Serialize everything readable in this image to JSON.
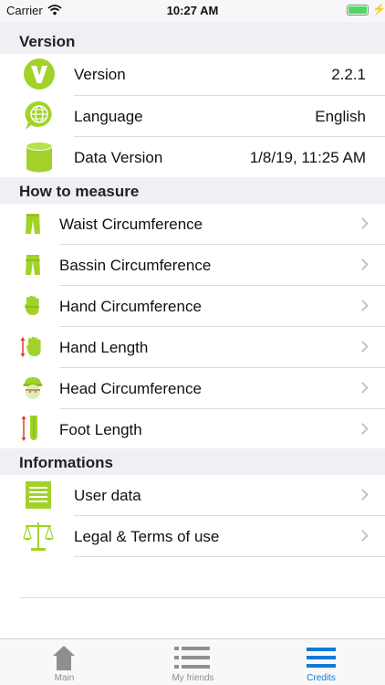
{
  "status_bar": {
    "carrier": "Carrier",
    "time": "10:27 AM"
  },
  "version_section": {
    "title": "Version",
    "rows": [
      {
        "label": "Version",
        "value": "2.2.1",
        "icon": "version-v-icon"
      },
      {
        "label": "Language",
        "value": "English",
        "icon": "globe-speech-icon"
      },
      {
        "label": "Data Version",
        "value": "1/8/19, 11:25 AM",
        "icon": "database-icon"
      }
    ]
  },
  "measure_section": {
    "title": "How to measure",
    "rows": [
      {
        "label": "Waist Circumference",
        "icon": "pants-icon"
      },
      {
        "label": "Bassin Circumference",
        "icon": "pants-icon"
      },
      {
        "label": "Hand Circumference",
        "icon": "hand-icon"
      },
      {
        "label": "Hand Length",
        "icon": "hand-length-icon"
      },
      {
        "label": "Head Circumference",
        "icon": "head-icon"
      },
      {
        "label": "Foot Length",
        "icon": "foot-length-icon"
      }
    ]
  },
  "info_section": {
    "title": "Informations",
    "rows": [
      {
        "label": "User data",
        "icon": "document-list-icon"
      },
      {
        "label": "Legal & Terms of use",
        "icon": "scales-icon"
      }
    ]
  },
  "tabbar": {
    "tabs": [
      {
        "label": "Main",
        "icon": "house-icon",
        "active": false
      },
      {
        "label": "My friends",
        "icon": "list-icon",
        "active": false
      },
      {
        "label": "Credits",
        "icon": "menu-lines-icon",
        "active": true
      }
    ]
  },
  "colors": {
    "accent_green": "#a2d22a",
    "active_tab": "#0f7ad8",
    "inactive_tab": "#8e8e93",
    "measure_arrow": "#d9402b"
  }
}
